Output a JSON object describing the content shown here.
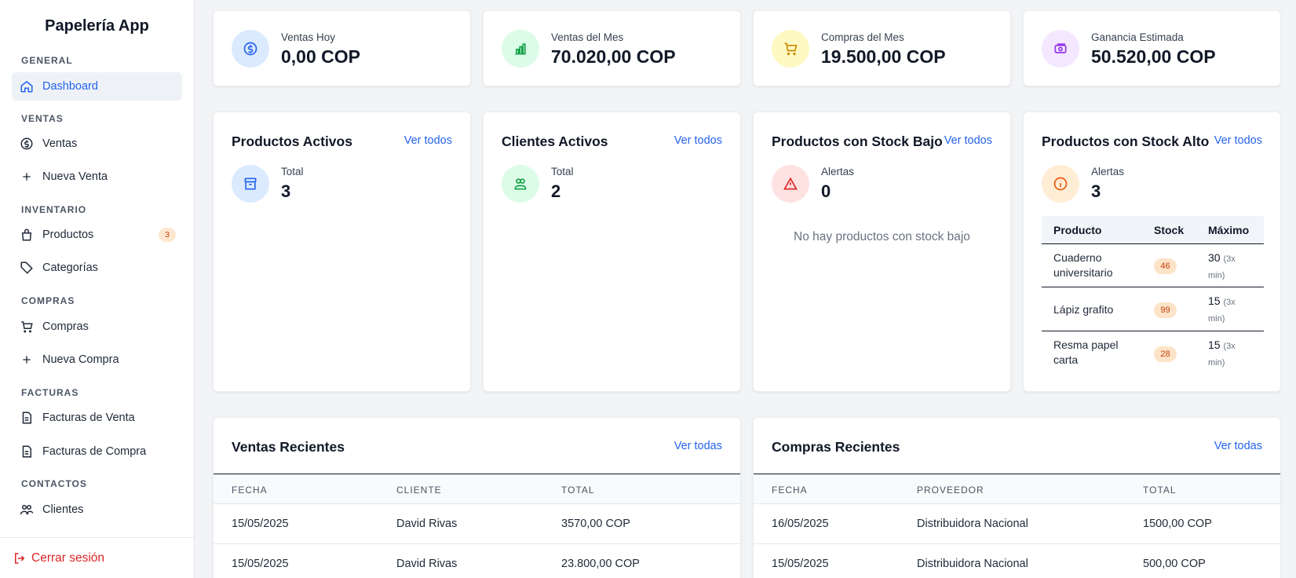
{
  "app": {
    "title": "Papelería App"
  },
  "sidebar": {
    "sections": [
      {
        "label": "GENERAL"
      },
      {
        "label": "VENTAS"
      },
      {
        "label": "INVENTARIO"
      },
      {
        "label": "COMPRAS"
      },
      {
        "label": "FACTURAS"
      },
      {
        "label": "CONTACTOS"
      }
    ],
    "items": [
      {
        "label": "Dashboard",
        "icon": "home-icon",
        "active": true
      },
      {
        "label": "Ventas",
        "icon": "dollar-circle-icon"
      },
      {
        "label": "Nueva Venta",
        "icon": "plus-icon"
      },
      {
        "label": "Productos",
        "icon": "bag-icon",
        "badge": "3"
      },
      {
        "label": "Categorías",
        "icon": "tag-icon"
      },
      {
        "label": "Compras",
        "icon": "cart-icon"
      },
      {
        "label": "Nueva Compra",
        "icon": "plus-icon"
      },
      {
        "label": "Facturas de Venta",
        "icon": "document-icon"
      },
      {
        "label": "Facturas de Compra",
        "icon": "document-icon"
      },
      {
        "label": "Clientes",
        "icon": "users-icon"
      }
    ],
    "logout": "Cerrar sesión"
  },
  "stats": [
    {
      "label": "Ventas Hoy",
      "value": "0,00 COP",
      "icon": "dollar-circle-icon",
      "color": "#2563eb",
      "bg": "#dbeafe"
    },
    {
      "label": "Ventas del Mes",
      "value": "70.020,00 COP",
      "icon": "bar-chart-icon",
      "color": "#16a34a",
      "bg": "#dcfce7"
    },
    {
      "label": "Compras del Mes",
      "value": "19.500,00 COP",
      "icon": "cart-icon",
      "color": "#ca8a04",
      "bg": "#fef9c3"
    },
    {
      "label": "Ganancia Estimada",
      "value": "50.520,00 COP",
      "icon": "money-icon",
      "color": "#9333ea",
      "bg": "#f3e8ff"
    }
  ],
  "panels": {
    "productos": {
      "title": "Productos Activos",
      "link": "Ver todos",
      "label": "Total",
      "value": "3"
    },
    "clientes": {
      "title": "Clientes Activos",
      "link": "Ver todos",
      "label": "Total",
      "value": "2"
    },
    "stock_bajo": {
      "title": "Productos con Stock Bajo",
      "link": "Ver todos",
      "label": "Alertas",
      "value": "0",
      "empty": "No hay productos con stock bajo"
    },
    "stock_alto": {
      "title": "Productos con Stock Alto",
      "link": "Ver todos",
      "label": "Alertas",
      "value": "3",
      "headers": [
        "Producto",
        "Stock",
        "Máximo"
      ],
      "rows": [
        {
          "name": "Cuaderno universitario",
          "stock": "46",
          "max": "30",
          "note": "(3x min)"
        },
        {
          "name": "Lápiz grafito",
          "stock": "99",
          "max": "15",
          "note": "(3x min)"
        },
        {
          "name": "Resma papel carta",
          "stock": "28",
          "max": "15",
          "note": "(3x min)"
        }
      ]
    }
  },
  "ventas_recientes": {
    "title": "Ventas Recientes",
    "link": "Ver todas",
    "headers": [
      "FECHA",
      "CLIENTE",
      "TOTAL"
    ],
    "rows": [
      {
        "fecha": "15/05/2025",
        "cliente": "David Rivas",
        "total": "3570,00 COP"
      },
      {
        "fecha": "15/05/2025",
        "cliente": "David Rivas",
        "total": "23.800,00 COP"
      }
    ]
  },
  "compras_recientes": {
    "title": "Compras Recientes",
    "link": "Ver todas",
    "headers": [
      "FECHA",
      "PROVEEDOR",
      "TOTAL"
    ],
    "rows": [
      {
        "fecha": "16/05/2025",
        "proveedor": "Distribuidora Nacional",
        "total": "1500,00 COP"
      },
      {
        "fecha": "15/05/2025",
        "proveedor": "Distribuidora Nacional",
        "total": "500,00 COP"
      }
    ]
  }
}
